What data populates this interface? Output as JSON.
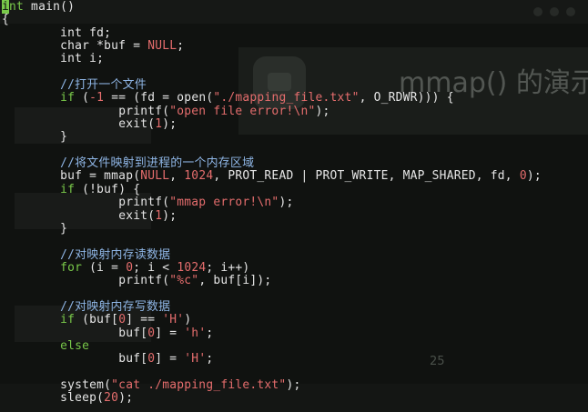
{
  "background": {
    "title": "mmap() 的演示",
    "page_number": "25"
  },
  "editor": {
    "lines": [
      [
        {
          "t": "i",
          "c": "cursor"
        },
        {
          "t": "nt",
          "c": "keyword"
        },
        {
          "t": " main()",
          "c": "plain"
        }
      ],
      [
        {
          "t": "{",
          "c": "plain"
        }
      ],
      [
        {
          "t": "        ",
          "c": "plain"
        },
        {
          "t": "int",
          "c": "type"
        },
        {
          "t": " fd;",
          "c": "plain"
        }
      ],
      [
        {
          "t": "        ",
          "c": "plain"
        },
        {
          "t": "char",
          "c": "type"
        },
        {
          "t": " *buf = ",
          "c": "plain"
        },
        {
          "t": "NULL",
          "c": "const"
        },
        {
          "t": ";",
          "c": "plain"
        }
      ],
      [
        {
          "t": "        ",
          "c": "plain"
        },
        {
          "t": "int",
          "c": "type"
        },
        {
          "t": " i;",
          "c": "plain"
        }
      ],
      [
        {
          "t": "",
          "c": "plain"
        }
      ],
      [
        {
          "t": "        ",
          "c": "plain"
        },
        {
          "t": "//打开一个文件",
          "c": "comment"
        }
      ],
      [
        {
          "t": "        ",
          "c": "plain"
        },
        {
          "t": "if",
          "c": "keyword"
        },
        {
          "t": " (",
          "c": "plain"
        },
        {
          "t": "-1",
          "c": "number"
        },
        {
          "t": " == (fd = open(",
          "c": "plain"
        },
        {
          "t": "\"./mapping_file.txt\"",
          "c": "string"
        },
        {
          "t": ", O_RDWR))) {",
          "c": "plain"
        }
      ],
      [
        {
          "t": "                ",
          "c": "plain"
        },
        {
          "t": "printf(",
          "c": "plain"
        },
        {
          "t": "\"open file error!\\n\"",
          "c": "string"
        },
        {
          "t": ");",
          "c": "plain"
        }
      ],
      [
        {
          "t": "                ",
          "c": "plain"
        },
        {
          "t": "exit(",
          "c": "plain"
        },
        {
          "t": "1",
          "c": "number"
        },
        {
          "t": ");",
          "c": "plain"
        }
      ],
      [
        {
          "t": "        }",
          "c": "plain"
        }
      ],
      [
        {
          "t": "",
          "c": "plain"
        }
      ],
      [
        {
          "t": "        ",
          "c": "plain"
        },
        {
          "t": "//将文件映射到进程的一个内存区域",
          "c": "comment"
        }
      ],
      [
        {
          "t": "        ",
          "c": "plain"
        },
        {
          "t": "buf = mmap(",
          "c": "plain"
        },
        {
          "t": "NULL",
          "c": "const"
        },
        {
          "t": ", ",
          "c": "plain"
        },
        {
          "t": "1024",
          "c": "number"
        },
        {
          "t": ", PROT_READ | PROT_WRITE, MAP_SHARED, fd, ",
          "c": "plain"
        },
        {
          "t": "0",
          "c": "number"
        },
        {
          "t": ");",
          "c": "plain"
        }
      ],
      [
        {
          "t": "        ",
          "c": "plain"
        },
        {
          "t": "if",
          "c": "keyword"
        },
        {
          "t": " (!buf) {",
          "c": "plain"
        }
      ],
      [
        {
          "t": "                ",
          "c": "plain"
        },
        {
          "t": "printf(",
          "c": "plain"
        },
        {
          "t": "\"mmap error!\\n\"",
          "c": "string"
        },
        {
          "t": ");",
          "c": "plain"
        }
      ],
      [
        {
          "t": "                ",
          "c": "plain"
        },
        {
          "t": "exit(",
          "c": "plain"
        },
        {
          "t": "1",
          "c": "number"
        },
        {
          "t": ");",
          "c": "plain"
        }
      ],
      [
        {
          "t": "        }",
          "c": "plain"
        }
      ],
      [
        {
          "t": "",
          "c": "plain"
        }
      ],
      [
        {
          "t": "        ",
          "c": "plain"
        },
        {
          "t": "//对映射内存读数据",
          "c": "comment"
        }
      ],
      [
        {
          "t": "        ",
          "c": "plain"
        },
        {
          "t": "for",
          "c": "keyword"
        },
        {
          "t": " (i = ",
          "c": "plain"
        },
        {
          "t": "0",
          "c": "number"
        },
        {
          "t": "; i < ",
          "c": "plain"
        },
        {
          "t": "1024",
          "c": "number"
        },
        {
          "t": "; i++)",
          "c": "plain"
        }
      ],
      [
        {
          "t": "                ",
          "c": "plain"
        },
        {
          "t": "printf(",
          "c": "plain"
        },
        {
          "t": "\"%c\"",
          "c": "string"
        },
        {
          "t": ", buf[i]);",
          "c": "plain"
        }
      ],
      [
        {
          "t": "",
          "c": "plain"
        }
      ],
      [
        {
          "t": "        ",
          "c": "plain"
        },
        {
          "t": "//对映射内存写数据",
          "c": "comment"
        }
      ],
      [
        {
          "t": "        ",
          "c": "plain"
        },
        {
          "t": "if",
          "c": "keyword"
        },
        {
          "t": " (buf[",
          "c": "plain"
        },
        {
          "t": "0",
          "c": "number"
        },
        {
          "t": "] == ",
          "c": "plain"
        },
        {
          "t": "'H'",
          "c": "string"
        },
        {
          "t": ")",
          "c": "plain"
        }
      ],
      [
        {
          "t": "                ",
          "c": "plain"
        },
        {
          "t": "buf[",
          "c": "plain"
        },
        {
          "t": "0",
          "c": "number"
        },
        {
          "t": "] = ",
          "c": "plain"
        },
        {
          "t": "'h'",
          "c": "string"
        },
        {
          "t": ";",
          "c": "plain"
        }
      ],
      [
        {
          "t": "        ",
          "c": "plain"
        },
        {
          "t": "else",
          "c": "keyword"
        }
      ],
      [
        {
          "t": "                ",
          "c": "plain"
        },
        {
          "t": "buf[",
          "c": "plain"
        },
        {
          "t": "0",
          "c": "number"
        },
        {
          "t": "] = ",
          "c": "plain"
        },
        {
          "t": "'H'",
          "c": "string"
        },
        {
          "t": ";",
          "c": "plain"
        }
      ],
      [
        {
          "t": "",
          "c": "plain"
        }
      ],
      [
        {
          "t": "        ",
          "c": "plain"
        },
        {
          "t": "system(",
          "c": "plain"
        },
        {
          "t": "\"cat ./mapping_file.txt\"",
          "c": "string"
        },
        {
          "t": ");",
          "c": "plain"
        }
      ],
      [
        {
          "t": "        ",
          "c": "plain"
        },
        {
          "t": "sleep(",
          "c": "plain"
        },
        {
          "t": "20",
          "c": "number"
        },
        {
          "t": ");",
          "c": "plain"
        }
      ]
    ]
  }
}
